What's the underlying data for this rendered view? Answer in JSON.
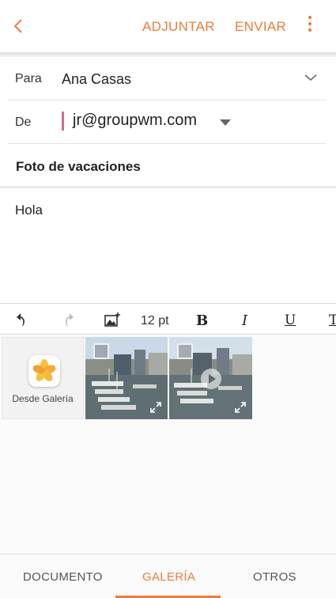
{
  "header": {
    "attach_label": "ADJUNTAR",
    "send_label": "ENVIAR"
  },
  "compose": {
    "to_label": "Para",
    "to_value": "Ana Casas",
    "from_label": "De",
    "from_value": "jr@groupwm.com",
    "subject": "Foto de vacaciones",
    "body": "Hola"
  },
  "toolbar": {
    "font_size": "12 pt",
    "bold": "B",
    "italic": "I",
    "underline": "U",
    "text_style": "T"
  },
  "gallery": {
    "from_gallery_label": "Desde Galería"
  },
  "tabs": [
    {
      "label": "DOCUMENTO"
    },
    {
      "label": "GALERÍA"
    },
    {
      "label": "OTROS"
    }
  ],
  "colors": {
    "accent": "#ef7a3a",
    "account_marker": "#d66b8b"
  }
}
